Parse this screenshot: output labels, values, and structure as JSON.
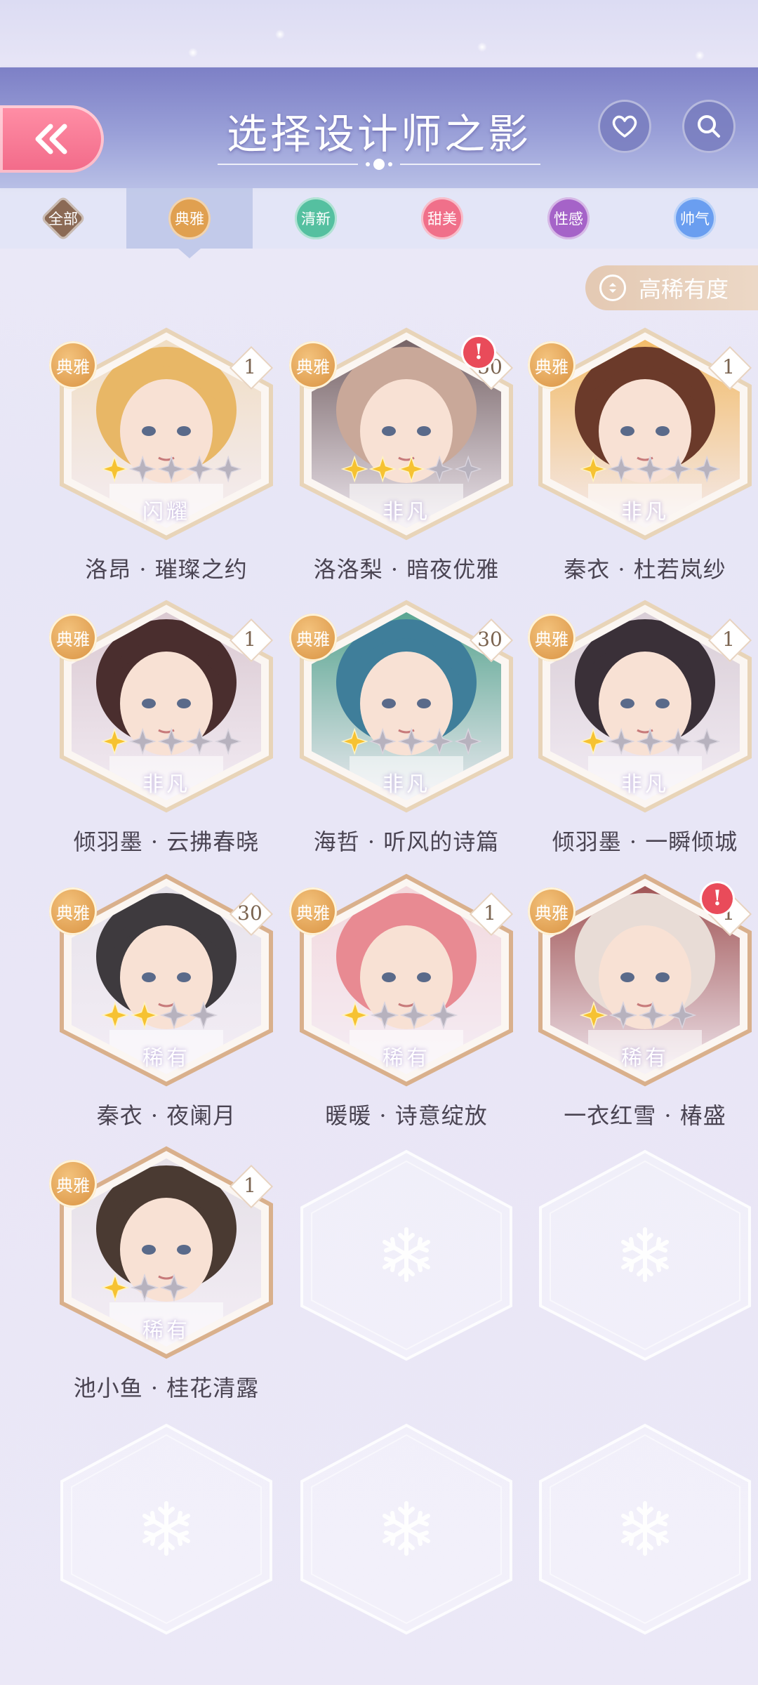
{
  "header": {
    "title": "选择设计师之影",
    "back_icon": "double-chevron-left-icon",
    "favorite_icon": "heart-icon",
    "search_icon": "search-icon"
  },
  "tabs": [
    {
      "label": "全部",
      "color": "#8b6a55",
      "shape": "diamond"
    },
    {
      "label": "典雅",
      "color": "#e0a050",
      "shape": "circle",
      "active": true
    },
    {
      "label": "清新",
      "color": "#55c0a0",
      "shape": "circle"
    },
    {
      "label": "甜美",
      "color": "#f0708a",
      "shape": "circle"
    },
    {
      "label": "性感",
      "color": "#a563c8",
      "shape": "circle"
    },
    {
      "label": "帅气",
      "color": "#6a9ef0",
      "shape": "circle"
    }
  ],
  "sort": {
    "label": "高稀有度",
    "icon": "sort-updown-icon"
  },
  "cards": [
    {
      "style": "典雅",
      "count": "1",
      "name": "洛昂 · 璀璨之约",
      "stars_filled": 1,
      "stars_total": 5,
      "rarity": "闪耀",
      "alert": false,
      "hair": "#e8b766",
      "bg": "#f0dcc0"
    },
    {
      "style": "典雅",
      "count": "50",
      "name": "洛洛梨 · 暗夜优雅",
      "stars_filled": 3,
      "stars_total": 5,
      "rarity": "非凡",
      "alert": true,
      "hair": "#c9a899",
      "bg": "#6e5a5c"
    },
    {
      "style": "典雅",
      "count": "1",
      "name": "秦衣 · 杜若岚纱",
      "stars_filled": 1,
      "stars_total": 5,
      "rarity": "非凡",
      "alert": false,
      "hair": "#6b3a2a",
      "bg": "#f2b860"
    },
    {
      "style": "典雅",
      "count": "1",
      "name": "倾羽墨 · 云拂春晓",
      "stars_filled": 1,
      "stars_total": 5,
      "rarity": "非凡",
      "alert": false,
      "hair": "#4a2e2e",
      "bg": "#d9c7cf"
    },
    {
      "style": "典雅",
      "count": "30",
      "name": "海哲 · 听风的诗篇",
      "stars_filled": 1,
      "stars_total": 5,
      "rarity": "非凡",
      "alert": false,
      "hair": "#3f7e9a",
      "bg": "#4fa08a"
    },
    {
      "style": "典雅",
      "count": "1",
      "name": "倾羽墨 · 一瞬倾城",
      "stars_filled": 1,
      "stars_total": 5,
      "rarity": "非凡",
      "alert": false,
      "hair": "#3a3038",
      "bg": "#d7cbd4"
    },
    {
      "style": "典雅",
      "count": "30",
      "name": "秦衣 · 夜阑月",
      "stars_filled": 2,
      "stars_total": 4,
      "rarity": "稀有",
      "alert": false,
      "hair": "#3e3a3e",
      "bg": "#e6e2ea"
    },
    {
      "style": "典雅",
      "count": "1",
      "name": "暖暖 · 诗意绽放",
      "stars_filled": 1,
      "stars_total": 4,
      "rarity": "稀有",
      "alert": false,
      "hair": "#e88a92",
      "bg": "#f3d8dc"
    },
    {
      "style": "典雅",
      "count": "1",
      "name": "一衣红雪 · 椿盛",
      "stars_filled": 1,
      "stars_total": 4,
      "rarity": "稀有",
      "alert": true,
      "hair": "#e8dcd6",
      "bg": "#9a4a4a"
    },
    {
      "style": "典雅",
      "count": "1",
      "name": "池小鱼 · 桂花清露",
      "stars_filled": 1,
      "stars_total": 3,
      "rarity": "稀有",
      "alert": false,
      "hair": "#4a3a32",
      "bg": "#e4dfe6"
    }
  ],
  "empty_slot_icon": "snowflake-icon"
}
